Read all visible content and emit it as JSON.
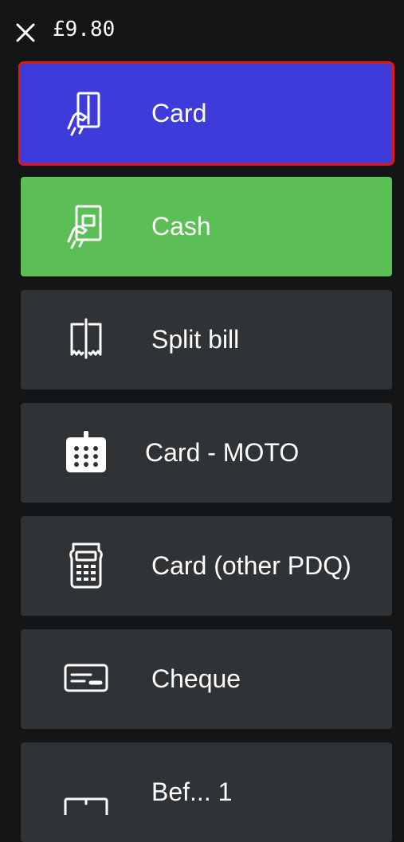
{
  "header": {
    "total": "£9.80"
  },
  "colors": {
    "background": "#141516",
    "tile_default": "#303336",
    "card_tile": "#3d3bd9",
    "cash_tile": "#5bbf55",
    "selection_outline": "#e01818"
  },
  "methods": [
    {
      "label": "Card",
      "icon": "card-in-hand-icon",
      "selected": true
    },
    {
      "label": "Cash",
      "icon": "cash-in-hand-icon",
      "selected": false
    },
    {
      "label": "Split bill",
      "icon": "split-bill-icon",
      "selected": false
    },
    {
      "label": "Card - MOTO",
      "icon": "card-machine-icon",
      "selected": false
    },
    {
      "label": "Card (other PDQ)",
      "icon": "pdq-terminal-icon",
      "selected": false
    },
    {
      "label": "Cheque",
      "icon": "cheque-icon",
      "selected": false
    },
    {
      "label": "Bef... 1",
      "icon": "voucher-icon",
      "selected": false
    }
  ]
}
